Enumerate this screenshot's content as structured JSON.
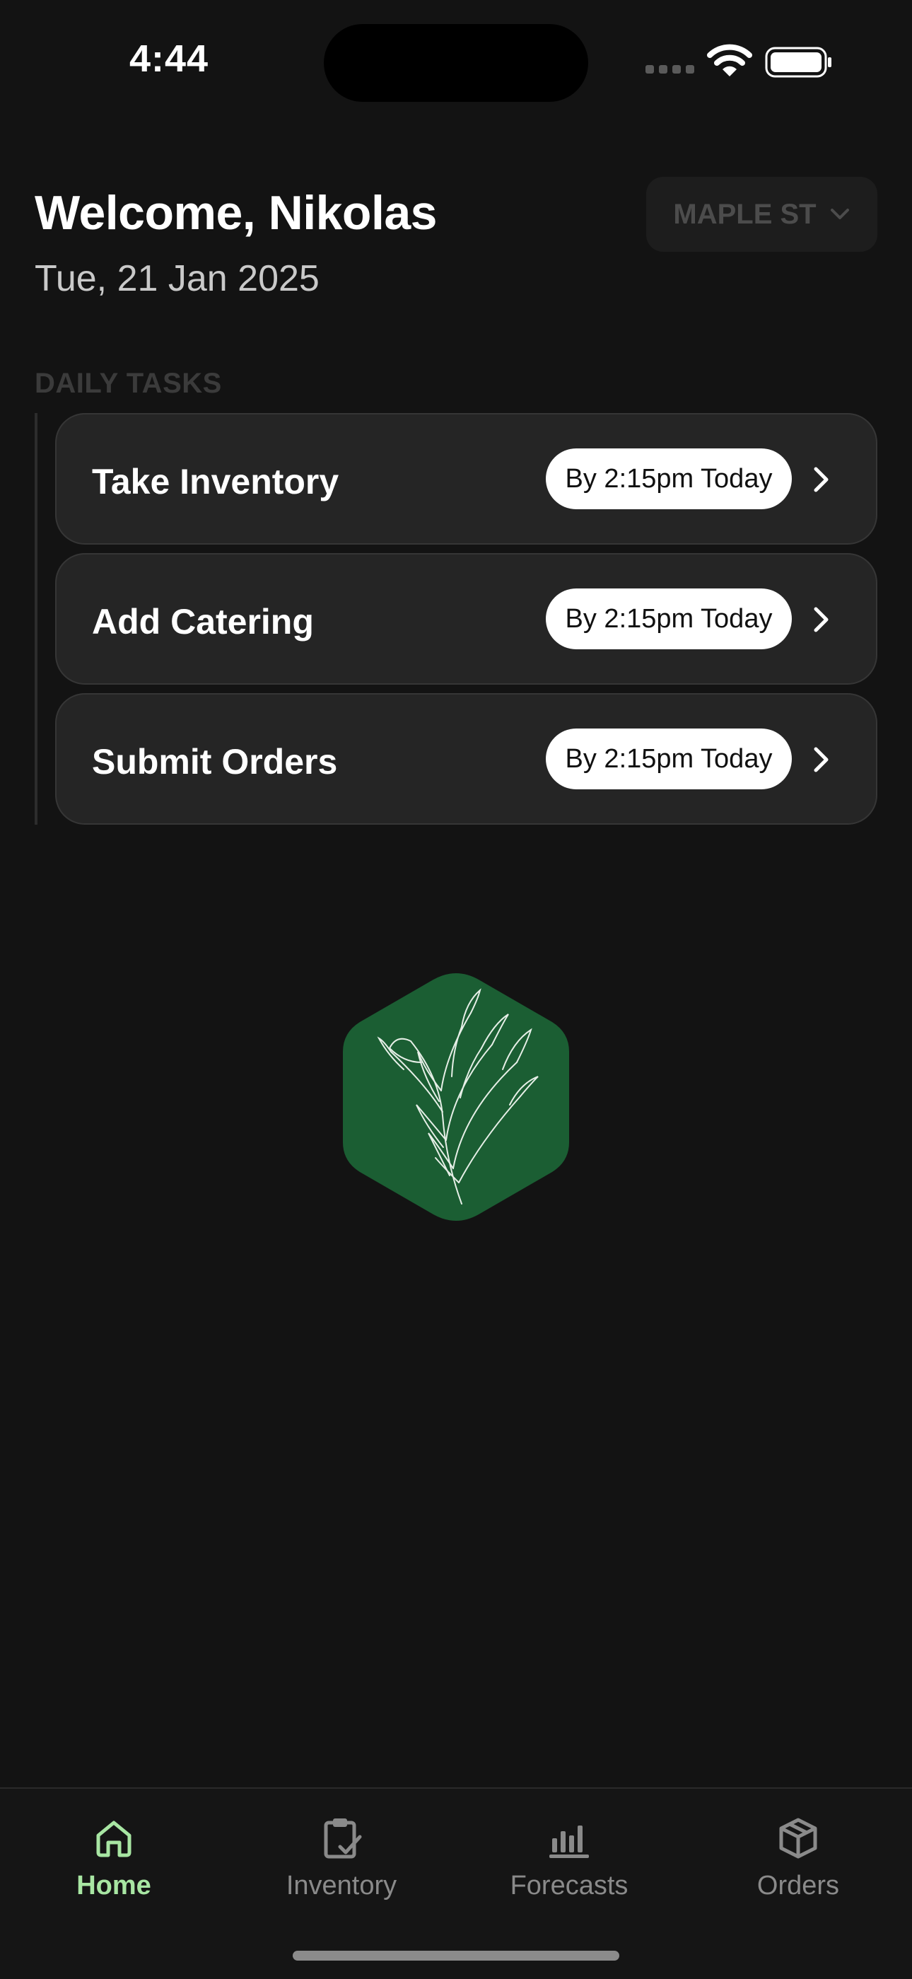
{
  "status_bar": {
    "time": "4:44"
  },
  "header": {
    "welcome": "Welcome, Nikolas",
    "date": "Tue, 21 Jan 2025",
    "location": "MAPLE ST"
  },
  "daily_tasks": {
    "label": "DAILY TASKS",
    "items": [
      {
        "title": "Take Inventory",
        "due": "By 2:15pm Today"
      },
      {
        "title": "Add Catering",
        "due": "By 2:15pm Today"
      },
      {
        "title": "Submit Orders",
        "due": "By 2:15pm Today"
      }
    ]
  },
  "tabbar": {
    "tabs": [
      {
        "label": "Home",
        "icon": "home-icon",
        "active": true
      },
      {
        "label": "Inventory",
        "icon": "clipboard-check-icon",
        "active": false
      },
      {
        "label": "Forecasts",
        "icon": "bar-chart-icon",
        "active": false
      },
      {
        "label": "Orders",
        "icon": "box-icon",
        "active": false
      }
    ]
  },
  "colors": {
    "background": "#131313",
    "card": "#252525",
    "accent": "#a8e6a3",
    "logo_green": "#1b5e33"
  }
}
